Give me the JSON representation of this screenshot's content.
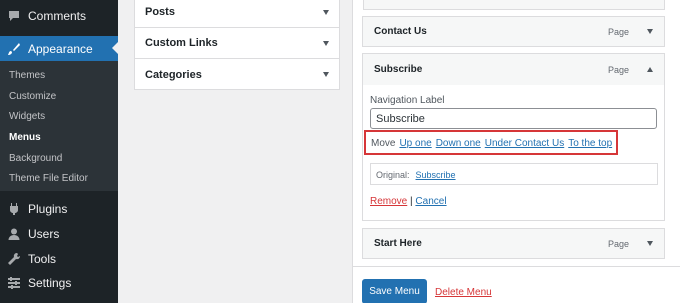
{
  "sidebar": {
    "comments": "Comments",
    "appearance": "Appearance",
    "submenu": {
      "themes": "Themes",
      "customize": "Customize",
      "widgets": "Widgets",
      "menus": "Menus",
      "background": "Background",
      "theme_file_editor": "Theme File Editor"
    },
    "plugins": "Plugins",
    "users": "Users",
    "tools": "Tools",
    "settings": "Settings"
  },
  "add_items": {
    "sections": [
      "Posts",
      "Custom Links",
      "Categories"
    ]
  },
  "menu_structure": {
    "items": [
      {
        "title": "Contact Us",
        "type": "Page"
      },
      {
        "title": "Subscribe",
        "type": "Page"
      },
      {
        "title": "Start Here",
        "type": "Page"
      }
    ],
    "settings": {
      "nav_label_caption": "Navigation Label",
      "nav_label_value": "Subscribe",
      "move_label": "Move",
      "move_links": [
        "Up one",
        "Down one",
        "Under Contact Us",
        "To the top"
      ],
      "original_label": "Original:",
      "original_link": "Subscribe",
      "remove": "Remove",
      "separator": "|",
      "cancel": "Cancel"
    },
    "save_button": "Save Menu",
    "delete_link": "Delete Menu"
  },
  "colors": {
    "sidebar_bg": "#1d2327",
    "submenu_bg": "#2c3338",
    "accent": "#2271b1",
    "highlight": "#d63638"
  }
}
